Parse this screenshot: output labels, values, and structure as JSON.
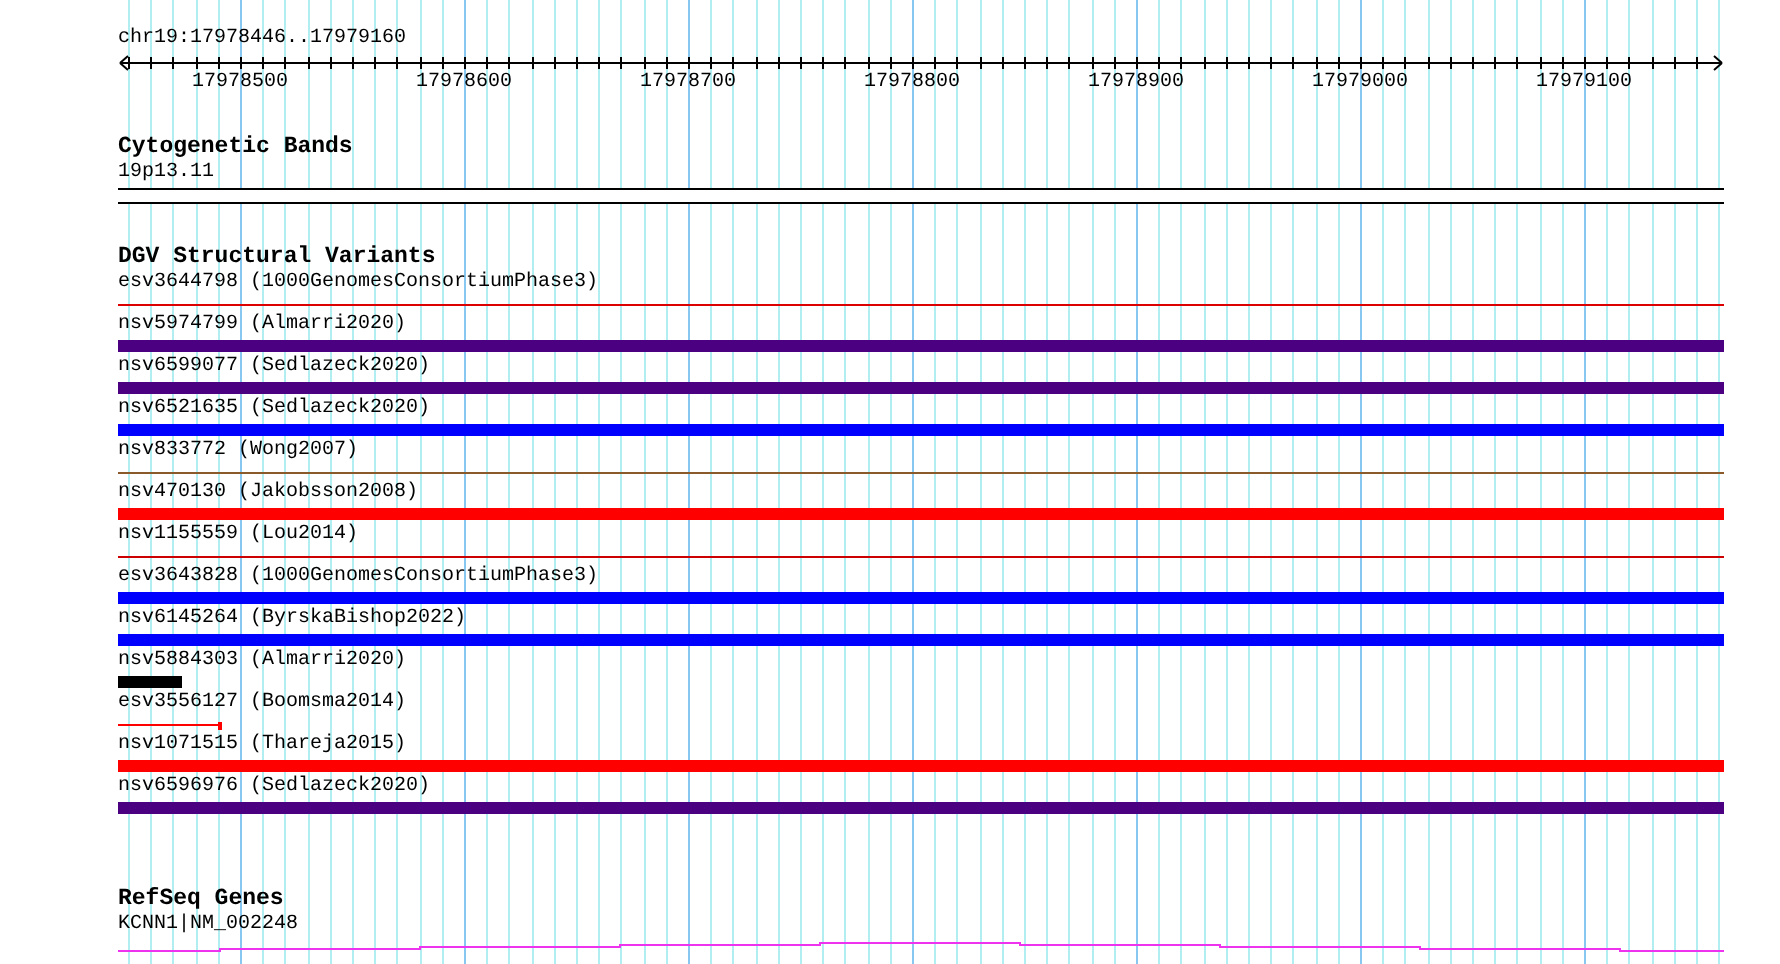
{
  "ruler": {
    "location": "chr19:17978446..17979160",
    "tick_labels": [
      "17978500",
      "17978600",
      "17978700",
      "17978800",
      "17978900",
      "17979000",
      "17979100"
    ]
  },
  "tracks": [
    {
      "kind": "cytobands",
      "title": "Cytogenetic Bands",
      "features": [
        {
          "label": "19p13.11"
        }
      ]
    },
    {
      "kind": "variants",
      "title": "DGV Structural Variants",
      "features": [
        {
          "label": "esv3644798 (1000GenomesConsortiumPhase3)",
          "kind": "line",
          "color": "#dd0000"
        },
        {
          "label": "nsv5974799 (Almarri2020)",
          "kind": "bar",
          "color": "#4b0082"
        },
        {
          "label": "nsv6599077 (Sedlazeck2020)",
          "kind": "bar",
          "color": "#4b0082"
        },
        {
          "label": "nsv6521635 (Sedlazeck2020)",
          "kind": "bar",
          "color": "#0000ff"
        },
        {
          "label": "nsv833772 (Wong2007)",
          "kind": "line",
          "color": "#8b5a2b"
        },
        {
          "label": "nsv470130 (Jakobsson2008)",
          "kind": "bar",
          "color": "#ff0000"
        },
        {
          "label": "nsv1155559 (Lou2014)",
          "kind": "line",
          "color": "#cc0000"
        },
        {
          "label": "esv3643828 (1000GenomesConsortiumPhase3)",
          "kind": "bar",
          "color": "#0000ff"
        },
        {
          "label": "nsv6145264 (ByrskaBishop2022)",
          "kind": "bar",
          "color": "#0000ff"
        },
        {
          "label": "nsv5884303 (Almarri2020)",
          "kind": "bar",
          "color": "#000000",
          "level": 0.04
        },
        {
          "label": "esv3556127 (Boomsma2014)",
          "kind": "capped_line",
          "color": "#ff0000",
          "level": 0.065
        },
        {
          "label": "nsv1071515 (Thareja2015)",
          "kind": "bar",
          "color": "#ff0000"
        },
        {
          "label": "nsv6596976 (Sedlazeck2020)",
          "kind": "bar",
          "color": "#4b0082"
        }
      ]
    },
    {
      "kind": "genes",
      "title": "RefSeq Genes",
      "features": [
        {
          "label": "KCNN1|NM_002248"
        }
      ]
    }
  ]
}
